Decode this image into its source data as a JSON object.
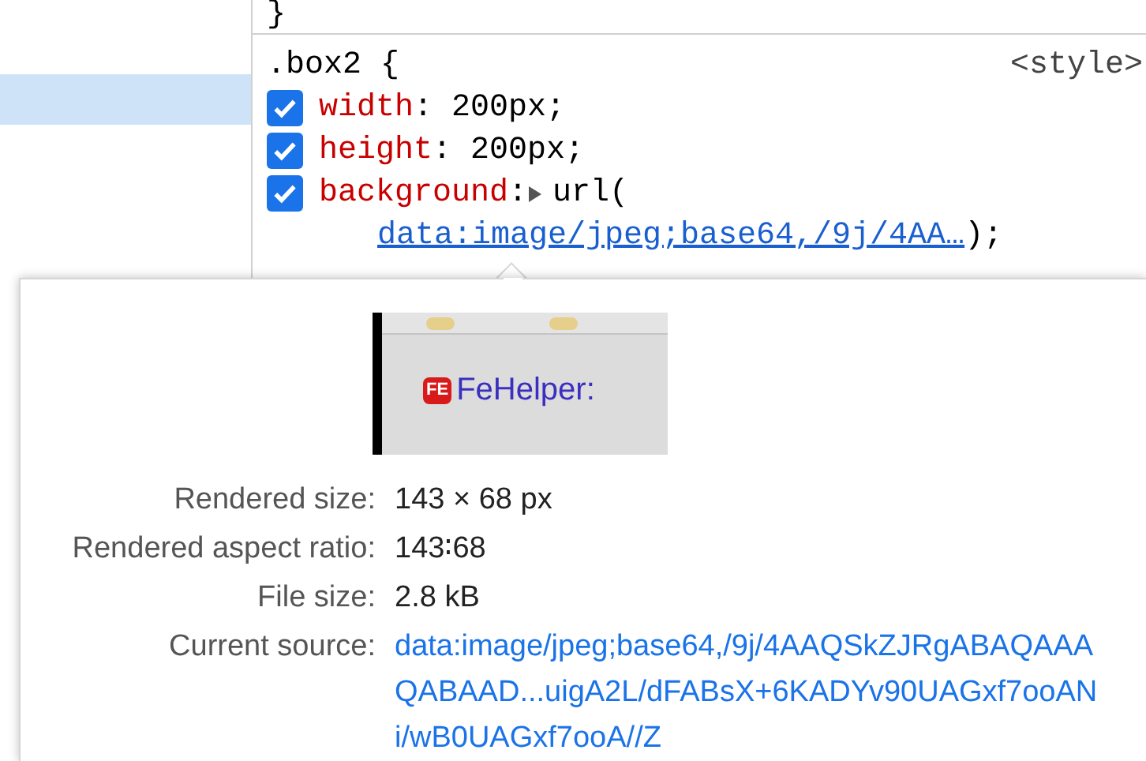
{
  "sidebar": {
    "rows": [
      {
        "selected": false
      },
      {
        "selected": true
      }
    ]
  },
  "styles": {
    "previous_rule_end": "}",
    "rule": {
      "selector": ".box2 {",
      "source": "<style>",
      "separator": ":",
      "declarations": [
        {
          "property": "width",
          "value": "200px;",
          "checked": true
        },
        {
          "property": "height",
          "value": "200px;",
          "checked": true
        },
        {
          "property": "background",
          "value": "url(",
          "checked": true,
          "expandable": true,
          "link": "data:image/jpeg;base64,/9j/4AA…",
          "suffix": ");"
        }
      ]
    }
  },
  "tooltip": {
    "preview": {
      "label": "FeHelper:",
      "logo": "FE"
    },
    "rows": [
      {
        "label": "Rendered size:",
        "value": "143 × 68 px",
        "kind": "text"
      },
      {
        "label": "Rendered aspect ratio:",
        "value": "143∶68",
        "kind": "text"
      },
      {
        "label": "File size:",
        "value": "2.8 kB",
        "kind": "text"
      },
      {
        "label": "Current source:",
        "value": "data:image/jpeg;base64,/9j/4AAQSkZJRgABAQAAAQABAAD...uigA2L/dFABsX+6KADYv90UAGxf7ooANi/wB0UAGxf7ooA//Z",
        "kind": "link"
      }
    ]
  }
}
